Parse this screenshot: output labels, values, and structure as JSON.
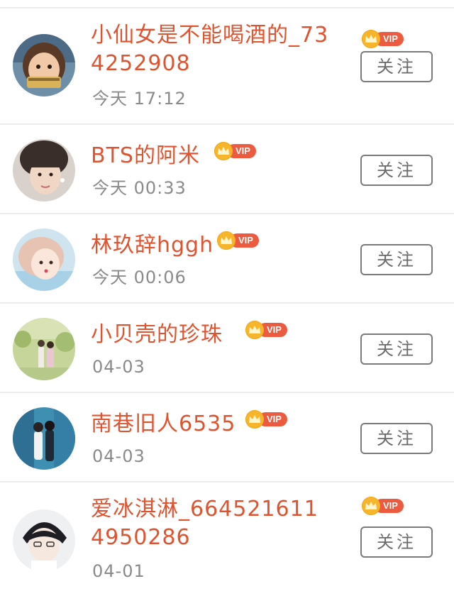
{
  "colors": {
    "name": "#e0532f",
    "time": "#8a8a8a",
    "vip_tag": "#ec5a3f",
    "crown": "#f7b52b",
    "button_border": "#7a7a7a",
    "divider": "#ececec"
  },
  "vip_label": "VIP",
  "follow_label": "关注",
  "users": [
    {
      "name": "小仙女是不能喝酒的_734252908",
      "time": "今天 17:12",
      "vip": true,
      "avatar": "avatar-girl-eating-icon"
    },
    {
      "name": "BTS的阿米",
      "time": "今天 00:33",
      "vip": true,
      "avatar": "avatar-boy-earring-icon"
    },
    {
      "name": "林玖辞hggh",
      "time": "今天 00:06",
      "vip": true,
      "avatar": "avatar-girl-lying-icon"
    },
    {
      "name": "小贝壳的珍珠",
      "time": "04-03",
      "vip": true,
      "avatar": "avatar-couple-garden-icon"
    },
    {
      "name": "南巷旧人6535",
      "time": "04-03",
      "vip": true,
      "avatar": "avatar-couple-city-icon"
    },
    {
      "name": "爱冰淇淋_6645216114950286",
      "time": "04-01",
      "vip": true,
      "avatar": "avatar-anime-boy-icon"
    }
  ]
}
